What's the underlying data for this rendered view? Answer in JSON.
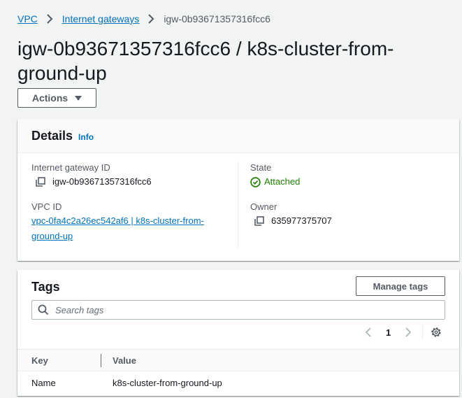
{
  "breadcrumb": {
    "items": [
      {
        "label": "VPC"
      },
      {
        "label": "Internet gateways"
      }
    ],
    "current": "igw-0b93671357316fcc6"
  },
  "page": {
    "title": "igw-0b93671357316fcc6 / k8s-cluster-from-ground-up",
    "actions_label": "Actions"
  },
  "details": {
    "title": "Details",
    "info_label": "Info",
    "igw_id_label": "Internet gateway ID",
    "igw_id_value": "igw-0b93671357316fcc6",
    "vpc_id_label": "VPC ID",
    "vpc_id_link_line1": "vpc-0fa4c2a26ec542af6 | k8s-cluster-from-",
    "vpc_id_link_line2": "ground-up",
    "state_label": "State",
    "state_value": "Attached",
    "owner_label": "Owner",
    "owner_value": "635977375707"
  },
  "tags": {
    "title": "Tags",
    "manage_label": "Manage tags",
    "search_placeholder": "Search tags",
    "page_number": "1",
    "columns": [
      "Key",
      "Value"
    ],
    "rows": [
      {
        "key": "Name",
        "value": "k8s-cluster-from-ground-up"
      }
    ]
  },
  "colors": {
    "link": "#0073bb",
    "success": "#1d8102",
    "text": "#16191f",
    "muted": "#545b64"
  },
  "icons": [
    "chevron-right-icon",
    "caret-down-icon",
    "copy-icon",
    "check-circle-icon",
    "search-icon",
    "chevron-left-icon",
    "gear-icon"
  ]
}
